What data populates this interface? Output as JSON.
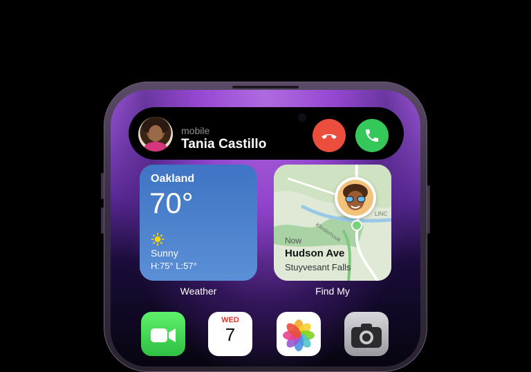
{
  "call": {
    "subtitle": "mobile",
    "name": "Tania Castillo",
    "decline_icon": "phone-down-icon",
    "accept_icon": "phone-icon",
    "colors": {
      "decline": "#eb4e3d",
      "accept": "#34c759"
    }
  },
  "weather_widget": {
    "city": "Oakland",
    "temperature": "70°",
    "condition": "Sunny",
    "high_low": "H:75° L:57°",
    "icon": "sun-icon",
    "label": "Weather"
  },
  "findmy_widget": {
    "time": "Now",
    "place": "Hudson Ave",
    "subplace": "Stuyvesant Falls",
    "map_label_1": "Klinderhook",
    "map_label_2": "LINC",
    "label": "Find My"
  },
  "dock_apps": [
    {
      "name": "FaceTime",
      "icon": "facetime-icon"
    },
    {
      "name": "Calendar",
      "icon": "calendar-icon",
      "day": "WED",
      "date": "7"
    },
    {
      "name": "Photos",
      "icon": "photos-icon"
    },
    {
      "name": "Camera",
      "icon": "camera-icon"
    }
  ]
}
